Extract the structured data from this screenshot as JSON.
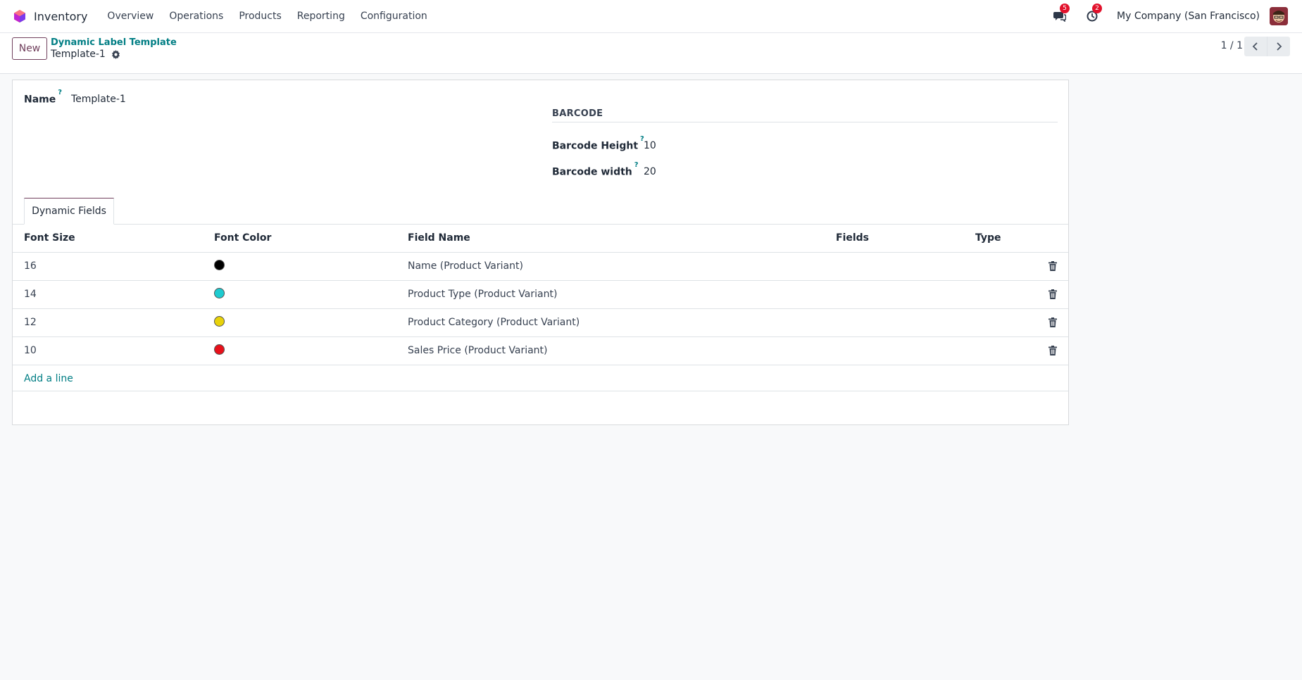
{
  "navbar": {
    "app_name": "Inventory",
    "menu": [
      "Overview",
      "Operations",
      "Products",
      "Reporting",
      "Configuration"
    ],
    "messages_badge": "5",
    "activities_badge": "2",
    "company": "My Company (San Francisco)"
  },
  "control_panel": {
    "new_label": "New",
    "breadcrumb_parent": "Dynamic Label Template",
    "breadcrumb_current": "Template-1",
    "pager": "1 / 1"
  },
  "form": {
    "name_label": "Name",
    "name_value": "Template-1",
    "help_mark": "?",
    "barcode_group_title": "BARCODE",
    "barcode_height_label": "Barcode Height",
    "barcode_height_value": "10",
    "barcode_width_label": "Barcode width",
    "barcode_width_value": "20"
  },
  "tabs": [
    "Dynamic Fields"
  ],
  "table": {
    "headers": [
      "Font Size",
      "Font Color",
      "Field Name",
      "Fields",
      "Type"
    ],
    "rows": [
      {
        "font_size": "16",
        "font_color": "#000000",
        "field_name": "Name (Product Variant)"
      },
      {
        "font_size": "14",
        "font_color": "#1ecbd0",
        "field_name": "Product Type (Product Variant)"
      },
      {
        "font_size": "12",
        "font_color": "#e8d20a",
        "field_name": "Product Category (Product Variant)"
      },
      {
        "font_size": "10",
        "font_color": "#e8101a",
        "field_name": "Sales Price (Product Variant)"
      }
    ],
    "add_line_label": "Add a line"
  },
  "colors": {
    "brand": "#71405d",
    "link": "#017e84",
    "badge": "#e2122c"
  }
}
